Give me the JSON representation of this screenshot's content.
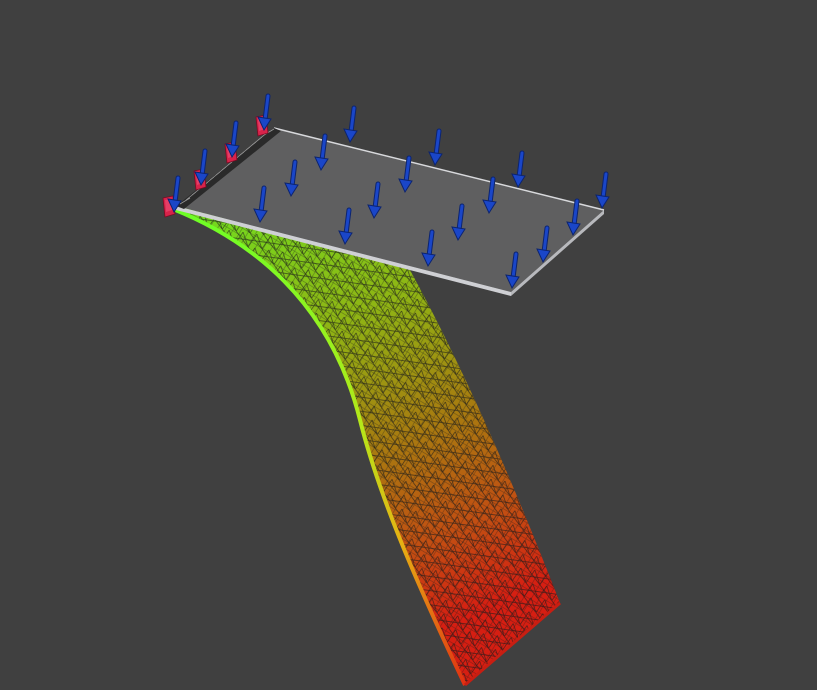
{
  "viewport": {
    "background": "#404040"
  },
  "model": {
    "undeformed_plate_color": "#5f5f60",
    "plate_edge_color": "#cfd0d4",
    "mesh_line_color": "#1a1a1a",
    "deformation_gradient": [
      "#7fe81e",
      "#b0a012",
      "#c74f12",
      "#d81e14"
    ]
  },
  "loads": {
    "arrow_color": "#1a46c8",
    "arrow_outline": "#0c2470",
    "icon": "force-arrow-icon"
  },
  "constraints": {
    "color": "#d8234a",
    "icon": "fixed-support-icon"
  }
}
